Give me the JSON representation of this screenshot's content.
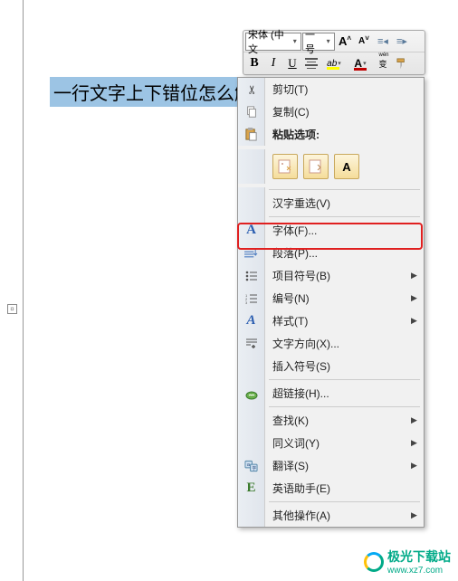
{
  "document": {
    "selected_text": "一行文字上下错位怎么解决"
  },
  "toolbar": {
    "font_name": "宋体 (中文",
    "font_size": "一号"
  },
  "context_menu": {
    "cut": "剪切(T)",
    "copy": "复制(C)",
    "paste_options_header": "粘贴选项:",
    "hanzi_reselect": "汉字重选(V)",
    "font": "字体(F)...",
    "paragraph": "段落(P)...",
    "bullets": "项目符号(B)",
    "numbering": "编号(N)",
    "styles": "样式(T)",
    "text_direction": "文字方向(X)...",
    "insert_symbol": "插入符号(S)",
    "hyperlink": "超链接(H)...",
    "lookup": "查找(K)",
    "synonyms": "同义词(Y)",
    "translate": "翻译(S)",
    "english_assistant": "英语助手(E)",
    "other_actions": "其他操作(A)"
  },
  "watermark": {
    "title": "极光下载站",
    "url": "www.xz7.com"
  }
}
